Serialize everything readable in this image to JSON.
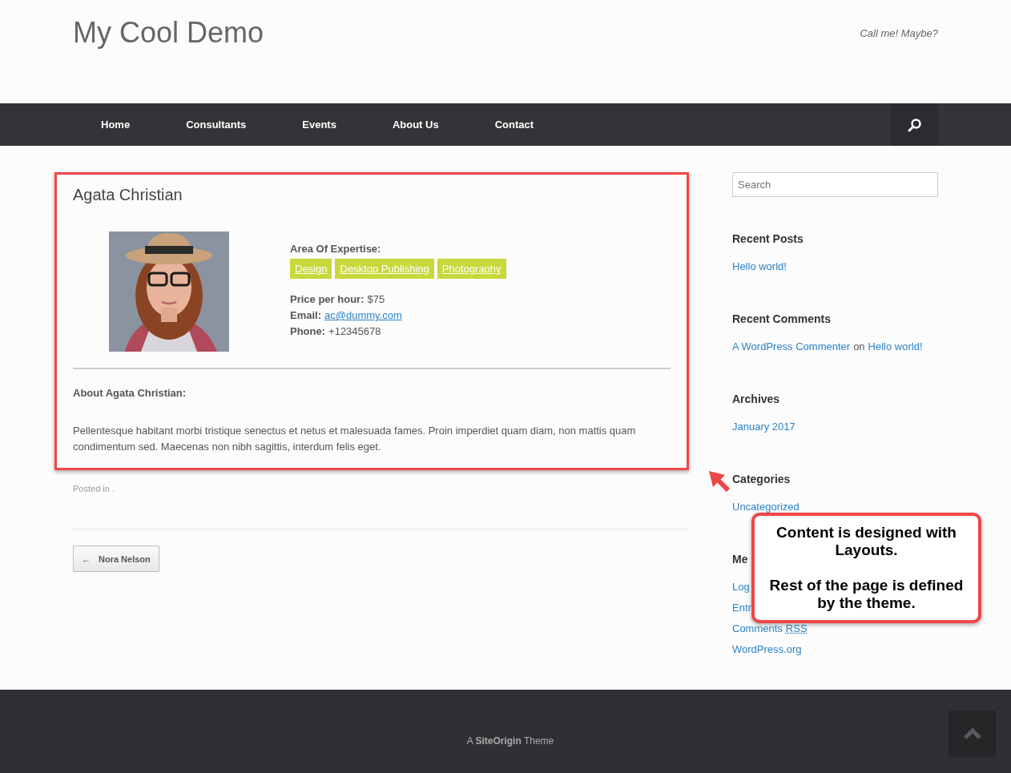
{
  "site": {
    "title": "My Cool Demo",
    "tagline": "Call me! Maybe?"
  },
  "nav": {
    "items": [
      {
        "label": "Home"
      },
      {
        "label": "Consultants"
      },
      {
        "label": "Events"
      },
      {
        "label": "About Us"
      },
      {
        "label": "Contact"
      }
    ]
  },
  "post": {
    "title": "Agata Christian",
    "photo": {
      "kind": "picture"
    },
    "expertise_label": "Area Of Expertise:",
    "tags": [
      "Design",
      "Desktop Publishing",
      "Photography"
    ],
    "fields": [
      {
        "label": "Price per hour:",
        "value": "$75",
        "kind": "text"
      },
      {
        "label": "Email:",
        "value": "ac@dummy.com",
        "kind": "link"
      },
      {
        "label": "Phone:",
        "value": "+12345678",
        "kind": "text"
      }
    ],
    "about_heading": "About Agata Christian:",
    "about_text": "Pellentesque habitant morbi tristique senectus et netus et malesuada fames. Proin imperdiet quam diam, non mattis quam condimentum sed. Maecenas non nibh sagittis, interdum felis eget.",
    "posted_in": "Posted in .",
    "prev_button": {
      "arrow": "←",
      "label": "Nora Nelson"
    }
  },
  "sidebar": {
    "search": {
      "placeholder": "Search"
    },
    "widgets": [
      {
        "title": "Recent Posts",
        "items": [
          [
            {
              "text": "Hello world!",
              "kind": "link"
            }
          ]
        ]
      },
      {
        "title": "Recent Comments",
        "items": [
          [
            {
              "text": "A WordPress Commenter",
              "kind": "link"
            },
            {
              "text": "on",
              "kind": "text"
            },
            {
              "text": "Hello world!",
              "kind": "link"
            }
          ]
        ]
      },
      {
        "title": "Archives",
        "items": [
          [
            {
              "text": "January 2017",
              "kind": "link"
            }
          ]
        ]
      },
      {
        "title": "Categories",
        "items": [
          [
            {
              "text": "Uncategorized",
              "kind": "link"
            }
          ]
        ]
      },
      {
        "title": "Me",
        "items": [
          [
            {
              "text": "Log",
              "kind": "link"
            }
          ],
          [
            {
              "text": "Entr",
              "kind": "link"
            }
          ],
          [
            {
              "text": "Comments",
              "kind": "link"
            },
            {
              "text": "RSS",
              "kind": "abbr"
            }
          ],
          [
            {
              "text": "WordPress.org",
              "kind": "link"
            }
          ]
        ]
      }
    ]
  },
  "callout": {
    "lines": [
      "Content is designed with Layouts.",
      "Rest of the page is defined by the theme."
    ]
  },
  "footer": {
    "credit": "A **SiteOrigin** Theme"
  }
}
